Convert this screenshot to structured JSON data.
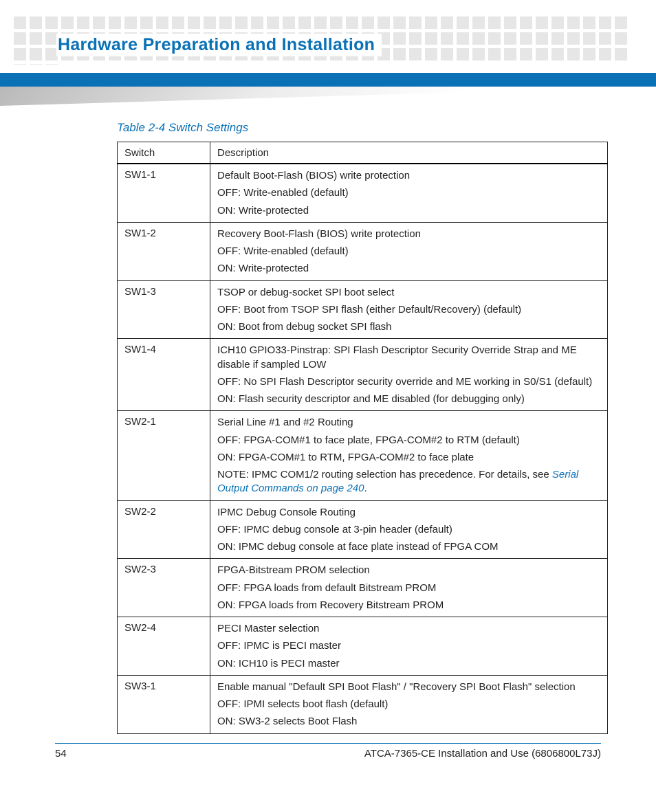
{
  "header": {
    "section_title": "Hardware Preparation and Installation"
  },
  "table": {
    "caption": "Table 2-4 Switch Settings",
    "columns": [
      "Switch",
      "Description"
    ],
    "rows": [
      {
        "switch": "SW1-1",
        "lines": [
          "Default Boot-Flash (BIOS) write protection",
          "OFF: Write-enabled (default)",
          "ON: Write-protected"
        ]
      },
      {
        "switch": "SW1-2",
        "lines": [
          "Recovery Boot-Flash (BIOS) write protection",
          "OFF: Write-enabled (default)",
          "ON: Write-protected"
        ]
      },
      {
        "switch": "SW1-3",
        "lines": [
          "TSOP or debug-socket SPI boot select",
          "OFF: Boot from TSOP SPI flash (either Default/Recovery) (default)",
          "ON: Boot from debug socket SPI flash"
        ]
      },
      {
        "switch": "SW1-4",
        "lines": [
          "ICH10 GPIO33-Pinstrap: SPI Flash Descriptor Security Override Strap and ME disable if sampled LOW",
          "OFF: No SPI Flash Descriptor security override and ME working in S0/S1 (default)",
          "ON: Flash security descriptor and ME disabled (for debugging only)"
        ]
      },
      {
        "switch": "SW2-1",
        "lines": [
          "Serial Line #1 and #2 Routing",
          "OFF: FPGA-COM#1 to face plate, FPGA-COM#2 to RTM (default)",
          "ON: FPGA-COM#1 to RTM, FPGA-COM#2 to face plate"
        ],
        "note_prefix": "NOTE: IPMC COM1/2 routing selection has precedence. For details, see ",
        "note_link": "Serial Output Commands on page 240",
        "note_suffix": "."
      },
      {
        "switch": "SW2-2",
        "lines": [
          "IPMC Debug Console Routing",
          "OFF: IPMC debug console at 3-pin header (default)",
          "ON: IPMC debug console at face plate instead of FPGA COM"
        ]
      },
      {
        "switch": "SW2-3",
        "lines": [
          "FPGA-Bitstream PROM selection",
          "OFF: FPGA loads from default Bitstream PROM",
          "ON: FPGA loads from Recovery Bitstream PROM"
        ]
      },
      {
        "switch": "SW2-4",
        "lines": [
          "PECI Master selection",
          "OFF: IPMC is PECI master",
          "ON: ICH10 is PECI master"
        ]
      },
      {
        "switch": "SW3-1",
        "lines": [
          "Enable manual \"Default SPI Boot Flash\" / \"Recovery SPI Boot Flash\" selection",
          "OFF: IPMI selects boot flash (default)",
          "ON: SW3-2 selects Boot Flash"
        ]
      }
    ]
  },
  "footer": {
    "page_number": "54",
    "doc_title": "ATCA-7365-CE Installation and Use (6806800L73J)"
  }
}
